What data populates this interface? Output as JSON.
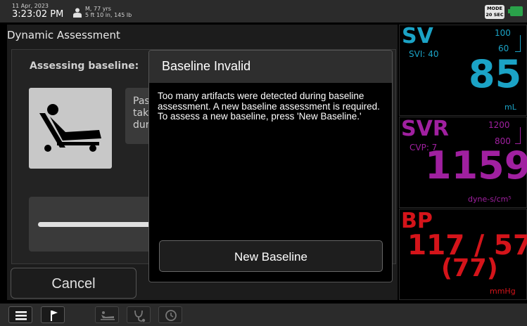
{
  "status": {
    "date": "11 Apr, 2023",
    "time": "3:23:02 PM",
    "patient_line1": "M, 77 yrs",
    "patient_line2": "5 ft 10 in, 145 lb",
    "patient_icon": "person-icon",
    "mode_line1": "MODE",
    "mode_line2": "20 SEC",
    "battery_icon": "battery-icon"
  },
  "left_panel": {
    "title": "Dynamic Assessment",
    "assessing_label": "Assessing baseline:",
    "info_line1": "Pas",
    "info_line2": "tak",
    "info_line3": "dur",
    "bed_icon": "patient-bed-icon",
    "cancel_label": "Cancel"
  },
  "modal": {
    "title": "Baseline Invalid",
    "body_line1": "Too many artifacts were detected during baseline assessment. A new baseline assessment is required.",
    "body_line2": "To assess a new baseline, press 'New Baseline.'",
    "button_label": "New Baseline"
  },
  "params": {
    "sv": {
      "label": "SV",
      "sub": "SVI: 40",
      "high": "100",
      "low": "60",
      "value": "85",
      "unit": "mL",
      "color": "#1ba3c6"
    },
    "svr": {
      "label": "SVR",
      "sub": "CVP: 7",
      "high": "1200",
      "low": "800",
      "value": "1159",
      "unit": "dyne-s/cm⁵",
      "color": "#a020a0"
    },
    "bp": {
      "label": "BP",
      "value": "117 / 57",
      "map": "(77)",
      "unit": "mmHg",
      "color": "#d4141a"
    }
  },
  "toolbar": {
    "icons": [
      "menu-icon",
      "flag-icon",
      "bed-icon",
      "stethoscope-icon",
      "history-icon"
    ]
  }
}
